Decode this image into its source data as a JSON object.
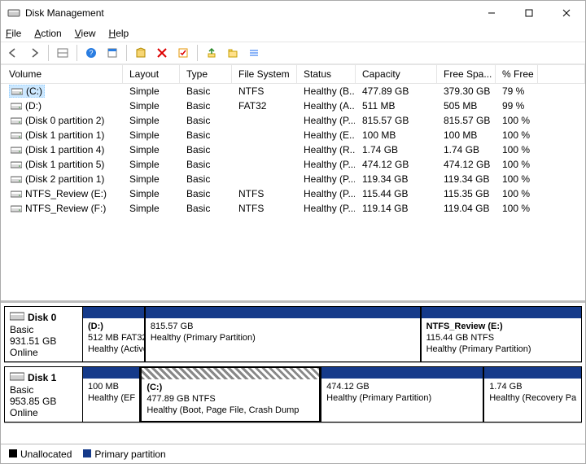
{
  "title": "Disk Management",
  "menus": {
    "file": "File",
    "action": "Action",
    "view": "View",
    "help": "Help"
  },
  "columns": {
    "volume": "Volume",
    "layout": "Layout",
    "type": "Type",
    "fs": "File System",
    "status": "Status",
    "capacity": "Capacity",
    "free": "Free Spa...",
    "pct": "% Free"
  },
  "volumes": [
    {
      "icon": "drive-icon",
      "name": "(C:)",
      "layout": "Simple",
      "type": "Basic",
      "fs": "NTFS",
      "status": "Healthy (B...",
      "capacity": "477.89 GB",
      "free": "379.30 GB",
      "pct": "79 %",
      "selected": true
    },
    {
      "icon": "drive-icon",
      "name": "(D:)",
      "layout": "Simple",
      "type": "Basic",
      "fs": "FAT32",
      "status": "Healthy (A...",
      "capacity": "511 MB",
      "free": "505 MB",
      "pct": "99 %"
    },
    {
      "icon": "drive-icon",
      "name": "(Disk 0 partition 2)",
      "layout": "Simple",
      "type": "Basic",
      "fs": "",
      "status": "Healthy (P...",
      "capacity": "815.57 GB",
      "free": "815.57 GB",
      "pct": "100 %"
    },
    {
      "icon": "drive-icon",
      "name": "(Disk 1 partition 1)",
      "layout": "Simple",
      "type": "Basic",
      "fs": "",
      "status": "Healthy (E...",
      "capacity": "100 MB",
      "free": "100 MB",
      "pct": "100 %"
    },
    {
      "icon": "drive-icon",
      "name": "(Disk 1 partition 4)",
      "layout": "Simple",
      "type": "Basic",
      "fs": "",
      "status": "Healthy (R...",
      "capacity": "1.74 GB",
      "free": "1.74 GB",
      "pct": "100 %"
    },
    {
      "icon": "drive-icon",
      "name": "(Disk 1 partition 5)",
      "layout": "Simple",
      "type": "Basic",
      "fs": "",
      "status": "Healthy (P...",
      "capacity": "474.12 GB",
      "free": "474.12 GB",
      "pct": "100 %"
    },
    {
      "icon": "drive-icon",
      "name": "(Disk 2 partition 1)",
      "layout": "Simple",
      "type": "Basic",
      "fs": "",
      "status": "Healthy (P...",
      "capacity": "119.34 GB",
      "free": "119.34 GB",
      "pct": "100 %"
    },
    {
      "icon": "drive-icon",
      "name": "NTFS_Review  (E:)",
      "layout": "Simple",
      "type": "Basic",
      "fs": "NTFS",
      "status": "Healthy (P...",
      "capacity": "115.44 GB",
      "free": "115.35 GB",
      "pct": "100 %"
    },
    {
      "icon": "drive-icon",
      "name": "NTFS_Review (F:)",
      "layout": "Simple",
      "type": "Basic",
      "fs": "NTFS",
      "status": "Healthy (P...",
      "capacity": "119.14 GB",
      "free": "119.04 GB",
      "pct": "100 %"
    }
  ],
  "disks": [
    {
      "name": "Disk 0",
      "type": "Basic",
      "size": "931.51 GB",
      "state": "Online",
      "parts": [
        {
          "title": "(D:)",
          "sub1": "512 MB FAT32",
          "sub2": "Healthy (Active, EFI S",
          "flex": "0.8"
        },
        {
          "title": "",
          "sub1": "815.57 GB",
          "sub2": "Healthy (Primary Partition)",
          "flex": "3.6"
        },
        {
          "title": "NTFS_Review   (E:)",
          "sub1": "115.44 GB NTFS",
          "sub2": "Healthy (Primary Partition)",
          "flex": "2.1"
        }
      ]
    },
    {
      "name": "Disk 1",
      "type": "Basic",
      "size": "953.85 GB",
      "state": "Online",
      "parts": [
        {
          "title": "",
          "sub1": "100 MB",
          "sub2": "Healthy (EF",
          "flex": "0.7"
        },
        {
          "title": "(C:)",
          "sub1": "477.89 GB NTFS",
          "sub2": "Healthy (Boot, Page File, Crash Dump",
          "flex": "2.2",
          "selected": true
        },
        {
          "title": "",
          "sub1": "474.12 GB",
          "sub2": "Healthy (Primary Partition)",
          "flex": "2.0"
        },
        {
          "title": "",
          "sub1": "1.74 GB",
          "sub2": "Healthy (Recovery Pa",
          "flex": "1.2"
        }
      ]
    }
  ],
  "legend": {
    "unallocated": "Unallocated",
    "primary": "Primary partition"
  }
}
